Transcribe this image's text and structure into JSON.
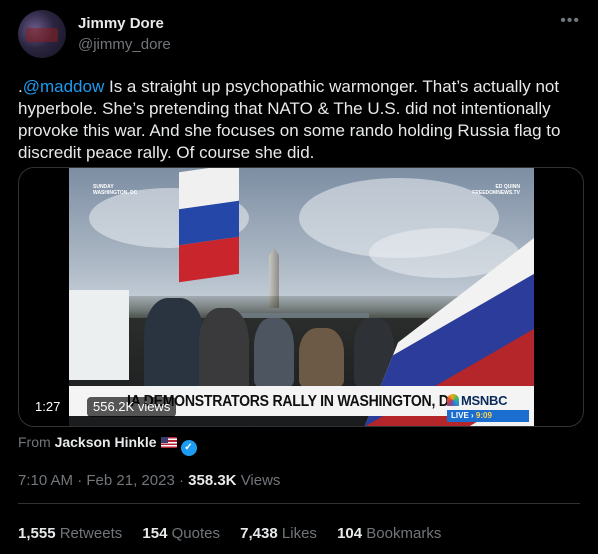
{
  "author": {
    "display_name": "Jimmy Dore",
    "handle": "@jimmy_dore",
    "more_icon": "ellipsis-icon"
  },
  "tweet": {
    "prefix": ".",
    "mention": "@maddow",
    "text": " Is a straight up psychopathic warmonger. That’s actually not hyperbole. She’s pretending that NATO & The U.S. did not intentionally provoke this war. And she focuses on some rando holding Russia flag to discredit peace rally. Of course she did."
  },
  "video": {
    "duration": "1:27",
    "views": "556.2K views",
    "corner_left_line1": "SUNDAY",
    "corner_left_line2": "WASHINGTON, DC",
    "corner_right_line1": "ED QUINN",
    "corner_right_line2": "FREEDOMNEWS.TV",
    "chyron": "IA DEMONSTRATORS RALLY IN WASHINGTON, DC",
    "network": "MSNBC",
    "live_label": "LIVE",
    "live_time": "9:09"
  },
  "source": {
    "from_label": "From",
    "name": "Jackson Hinkle",
    "flag_icon": "us-flag-icon",
    "verified_icon": "verified-badge-icon"
  },
  "meta": {
    "time": "7:10 AM",
    "date": "Feb 21, 2023",
    "separator": "·",
    "views_count": "358.3K",
    "views_label": "Views"
  },
  "stats": {
    "retweets_count": "1,555",
    "retweets_label": "Retweets",
    "quotes_count": "154",
    "quotes_label": "Quotes",
    "likes_count": "7,438",
    "likes_label": "Likes",
    "bookmarks_count": "104",
    "bookmarks_label": "Bookmarks"
  },
  "colors": {
    "background": "#000000",
    "text": "#e7e9ea",
    "secondary": "#71767b",
    "accent": "#1d9bf0"
  }
}
